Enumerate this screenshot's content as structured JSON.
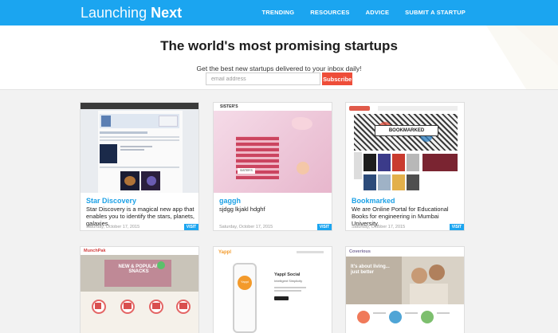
{
  "header": {
    "logo_light": "Launching",
    "logo_bold": "Next",
    "nav": [
      "TRENDING",
      "RESOURCES",
      "ADVICE",
      "SUBMIT A STARTUP"
    ]
  },
  "hero": {
    "title": "The world's most promising startups",
    "subtitle": "Get the best new startups delivered to your inbox daily!",
    "email_placeholder": "email address",
    "subscribe_label": "Subscribe"
  },
  "cards": [
    {
      "title": "Star Discovery",
      "description": "Star Discovery is a magical new app that enables you to identify the stars, planets, galaxies.",
      "date": "Saturday, October 17, 2015",
      "visit": "VISIT"
    },
    {
      "title": "gaggh",
      "description": "sjdgg lkjakl hdghf",
      "date": "Saturday, October 17, 2015",
      "visit": "VISIT"
    },
    {
      "title": "Bookmarked",
      "description": "We are Online Portal for Educational Books for engineering in Mumbai University.",
      "date": "Saturday, October 17, 2015",
      "visit": "VISIT"
    }
  ],
  "thumb_text": {
    "sisters": "SISTER'S",
    "bookmarked_banner": "BOOKMARKED",
    "yappi": "Yappl",
    "yappi_social": "Yappl Social",
    "yappi_tagline": "Intelligent Simplicity",
    "yappi_cta": "Yappi",
    "munch": "MunchPak",
    "munch_banner": "NEW & POPULAR SNACKS",
    "coverious": "Coverious",
    "coverious_tagline": "It's about living... just better"
  },
  "colors": {
    "header_bg": "#1ba5f0",
    "subscribe_bg": "#ee4d39",
    "card_title": "#1da1e6",
    "grid_bg": "#f2f2f2"
  }
}
